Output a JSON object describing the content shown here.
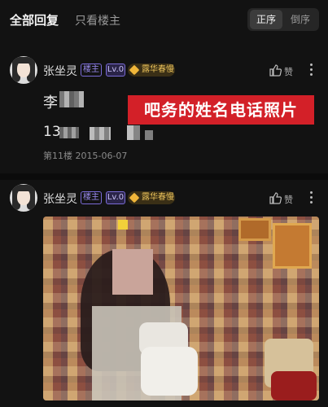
{
  "header": {
    "tab_all": "全部回复",
    "tab_op_only": "只看楼主",
    "sort_asc": "正序",
    "sort_desc": "倒序"
  },
  "posts": [
    {
      "username": "张坐灵",
      "badge_op": "楼主",
      "level": "Lv.0",
      "title_badge": "露华春慢",
      "like_label": "赞",
      "content_line1_visible": "李",
      "content_line2_visible": "13",
      "floor_meta": "第11楼  2015-06-07"
    },
    {
      "username": "张坐灵",
      "badge_op": "楼主",
      "level": "Lv.0",
      "title_badge": "露华春慢",
      "like_label": "赞"
    }
  ],
  "overlay": {
    "red_caption": "吧务的姓名电话照片"
  },
  "colors": {
    "background": "#121212",
    "accent_purple": "#7a6bd6",
    "gold": "#e9c15a",
    "red_caption_bg": "#d32028"
  }
}
